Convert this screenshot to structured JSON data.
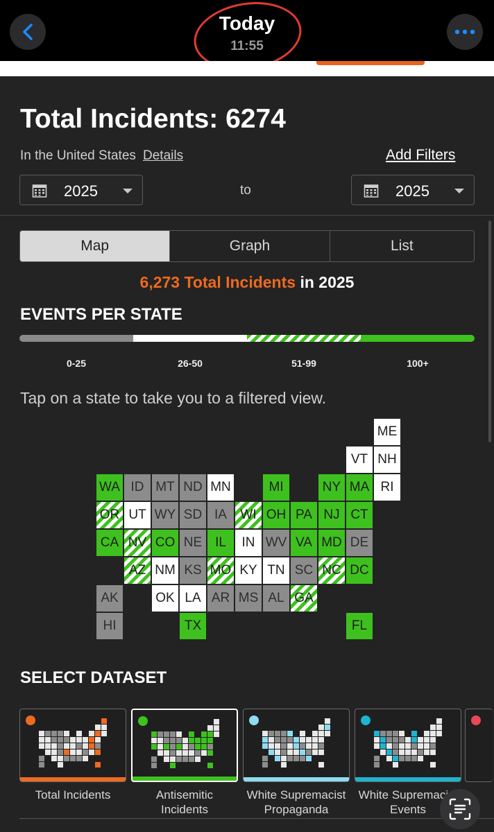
{
  "viewer": {
    "title": "Today",
    "time": "11:55"
  },
  "header": {
    "title": "Total Incidents: 6274",
    "location": "In the United States",
    "details_link": "Details",
    "add_filters": "Add Filters",
    "from_year": "2025",
    "to_label": "to",
    "to_year": "2025"
  },
  "tabs": [
    {
      "label": "Map",
      "active": true
    },
    {
      "label": "Graph",
      "active": false
    },
    {
      "label": "List",
      "active": false
    }
  ],
  "summary": {
    "count_text": "6,273 Total Incidents",
    "suffix": " in 2025"
  },
  "events_per_state": {
    "title": "EVENTS PER STATE",
    "ranges": [
      "0-25",
      "26-50",
      "51-99",
      "100+"
    ]
  },
  "tap_hint": "Tap on a state to take you to a filtered view.",
  "states": [
    {
      "abbr": "ME",
      "col": 10,
      "row": 0,
      "level": "white"
    },
    {
      "abbr": "VT",
      "col": 9,
      "row": 1,
      "level": "white"
    },
    {
      "abbr": "NH",
      "col": 10,
      "row": 1,
      "level": "white"
    },
    {
      "abbr": "WA",
      "col": 0,
      "row": 2,
      "level": "green"
    },
    {
      "abbr": "ID",
      "col": 1,
      "row": 2,
      "level": "grey"
    },
    {
      "abbr": "MT",
      "col": 2,
      "row": 2,
      "level": "grey"
    },
    {
      "abbr": "ND",
      "col": 3,
      "row": 2,
      "level": "grey"
    },
    {
      "abbr": "MN",
      "col": 4,
      "row": 2,
      "level": "white"
    },
    {
      "abbr": "MI",
      "col": 6,
      "row": 2,
      "level": "green"
    },
    {
      "abbr": "NY",
      "col": 8,
      "row": 2,
      "level": "green"
    },
    {
      "abbr": "MA",
      "col": 9,
      "row": 2,
      "level": "green"
    },
    {
      "abbr": "RI",
      "col": 10,
      "row": 2,
      "level": "white"
    },
    {
      "abbr": "OR",
      "col": 0,
      "row": 3,
      "level": "stripe"
    },
    {
      "abbr": "UT",
      "col": 1,
      "row": 3,
      "level": "white"
    },
    {
      "abbr": "WY",
      "col": 2,
      "row": 3,
      "level": "grey"
    },
    {
      "abbr": "SD",
      "col": 3,
      "row": 3,
      "level": "grey"
    },
    {
      "abbr": "IA",
      "col": 4,
      "row": 3,
      "level": "grey"
    },
    {
      "abbr": "WI",
      "col": 5,
      "row": 3,
      "level": "stripe"
    },
    {
      "abbr": "OH",
      "col": 6,
      "row": 3,
      "level": "green"
    },
    {
      "abbr": "PA",
      "col": 7,
      "row": 3,
      "level": "green"
    },
    {
      "abbr": "NJ",
      "col": 8,
      "row": 3,
      "level": "green"
    },
    {
      "abbr": "CT",
      "col": 9,
      "row": 3,
      "level": "green"
    },
    {
      "abbr": "CA",
      "col": 0,
      "row": 4,
      "level": "green"
    },
    {
      "abbr": "NV",
      "col": 1,
      "row": 4,
      "level": "stripe"
    },
    {
      "abbr": "CO",
      "col": 2,
      "row": 4,
      "level": "green"
    },
    {
      "abbr": "NE",
      "col": 3,
      "row": 4,
      "level": "grey"
    },
    {
      "abbr": "IL",
      "col": 4,
      "row": 4,
      "level": "green"
    },
    {
      "abbr": "IN",
      "col": 5,
      "row": 4,
      "level": "white"
    },
    {
      "abbr": "WV",
      "col": 6,
      "row": 4,
      "level": "grey"
    },
    {
      "abbr": "VA",
      "col": 7,
      "row": 4,
      "level": "green"
    },
    {
      "abbr": "MD",
      "col": 8,
      "row": 4,
      "level": "green"
    },
    {
      "abbr": "DE",
      "col": 9,
      "row": 4,
      "level": "grey"
    },
    {
      "abbr": "AZ",
      "col": 1,
      "row": 5,
      "level": "stripe"
    },
    {
      "abbr": "NM",
      "col": 2,
      "row": 5,
      "level": "white"
    },
    {
      "abbr": "KS",
      "col": 3,
      "row": 5,
      "level": "grey"
    },
    {
      "abbr": "MO",
      "col": 4,
      "row": 5,
      "level": "stripe"
    },
    {
      "abbr": "KY",
      "col": 5,
      "row": 5,
      "level": "white"
    },
    {
      "abbr": "TN",
      "col": 6,
      "row": 5,
      "level": "white"
    },
    {
      "abbr": "SC",
      "col": 7,
      "row": 5,
      "level": "grey"
    },
    {
      "abbr": "NC",
      "col": 8,
      "row": 5,
      "level": "stripe"
    },
    {
      "abbr": "DC",
      "col": 9,
      "row": 5,
      "level": "green"
    },
    {
      "abbr": "AK",
      "col": 0,
      "row": 6,
      "level": "grey"
    },
    {
      "abbr": "OK",
      "col": 2,
      "row": 6,
      "level": "white"
    },
    {
      "abbr": "LA",
      "col": 3,
      "row": 6,
      "level": "white"
    },
    {
      "abbr": "AR",
      "col": 4,
      "row": 6,
      "level": "grey"
    },
    {
      "abbr": "MS",
      "col": 5,
      "row": 6,
      "level": "grey"
    },
    {
      "abbr": "AL",
      "col": 6,
      "row": 6,
      "level": "grey"
    },
    {
      "abbr": "GA",
      "col": 7,
      "row": 6,
      "level": "stripe"
    },
    {
      "abbr": "HI",
      "col": 0,
      "row": 7,
      "level": "grey"
    },
    {
      "abbr": "TX",
      "col": 3,
      "row": 7,
      "level": "green"
    },
    {
      "abbr": "FL",
      "col": 9,
      "row": 7,
      "level": "green"
    }
  ],
  "dataset": {
    "title": "SELECT DATASET",
    "options": [
      {
        "label": "Total Incidents",
        "color": "#ee6a1f",
        "selected": false
      },
      {
        "label": "Antisemitic Incidents",
        "color": "#3ec11e",
        "selected": true
      },
      {
        "label": "White Supremacist Propaganda",
        "color": "#8fdcf2",
        "selected": false
      },
      {
        "label": "White Supremacist Events",
        "color": "#1fb3cf",
        "selected": false
      }
    ]
  },
  "colors": {
    "accent_orange": "#ee6a1f",
    "green": "#3ec11e",
    "grey": "#8c8c8c",
    "background": "#232323"
  }
}
